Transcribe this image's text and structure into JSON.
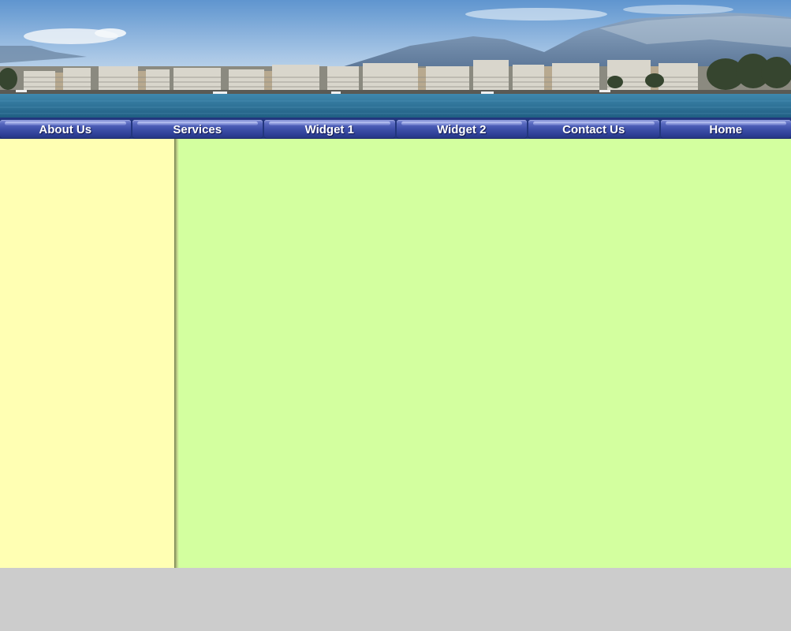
{
  "banner": {
    "alt": "Geneva lakeside panorama with mountains",
    "colors": {
      "sky_top": "#5f95cf",
      "sky_bottom": "#cddff0",
      "lake": "#2e7195",
      "mountain": "#6e8db0"
    }
  },
  "nav": {
    "items": [
      {
        "id": "about",
        "label": "About Us"
      },
      {
        "id": "services",
        "label": "Services"
      },
      {
        "id": "widget1",
        "label": "Widget 1"
      },
      {
        "id": "widget2",
        "label": "Widget 2"
      },
      {
        "id": "contact",
        "label": "Contact Us"
      },
      {
        "id": "home",
        "label": "Home"
      }
    ],
    "colors": {
      "bar": "#3d4fa8",
      "text": "#ffffff"
    }
  },
  "layout_colors": {
    "sidebar": "#ffffb3",
    "main": "#d3ff9f",
    "footer": "#cccccc"
  }
}
